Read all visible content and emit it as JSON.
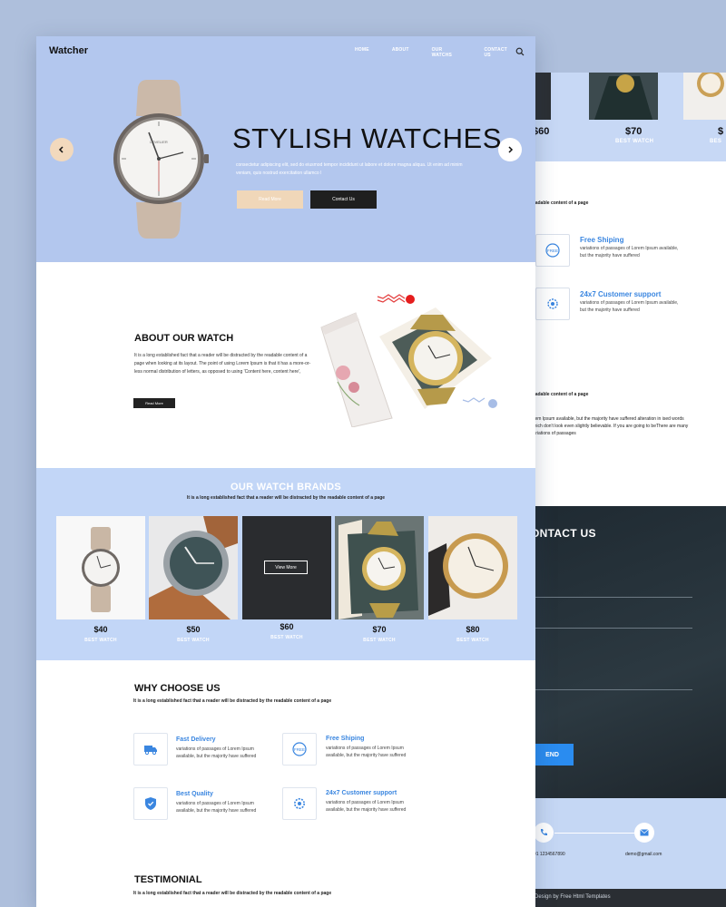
{
  "header": {
    "logo": "Watcher",
    "nav": [
      "HOME",
      "ABOUT",
      "OUR WATCHS",
      "CONTACT US"
    ]
  },
  "hero": {
    "title": "STYLISH WATCHES",
    "description": "consectetur adipiscing elit, sed do eiusmod tempor incididunt ut labore et dolore magna aliqua. Ut enim ad minim veniam, quis nostrud exercitation ullamco l",
    "read_more": "Read More",
    "contact_us": "Contact Us",
    "watch_brand_text": "LOVELIER"
  },
  "about": {
    "title": "ABOUT OUR WATCH",
    "text": "It is a long established fact that a reader will be distracted by the readable content of a page when looking at its layout. The point of using Lorem Ipsum is that it has a more-or-less normal distribution of letters, as opposed to using 'Content here, content here',",
    "button": "Read More"
  },
  "brands": {
    "title": "OUR WATCH BRANDS",
    "subtitle": "It is a long established fact that a reader will be distracted by the readable content of a page",
    "items": [
      {
        "price": "$40",
        "label": "BEST WATCH"
      },
      {
        "price": "$50",
        "label": "BEST WATCH"
      },
      {
        "price": "$60",
        "label": "BEST WATCH"
      },
      {
        "price": "$70",
        "label": "BEST WATCH"
      },
      {
        "price": "$80",
        "label": "BEST WATCH"
      }
    ],
    "view_more": "View More"
  },
  "why": {
    "title": "WHY CHOOSE US",
    "subtitle": "It is a long established fact that a reader will be distracted by the readable content of a page",
    "features": [
      {
        "title": "Fast Delivery",
        "desc": "variations of passages of Lorem Ipsum available, but the majority have suffered",
        "icon": "truck-icon"
      },
      {
        "title": "Free Shiping",
        "desc": "variations of passages of Lorem Ipsum available, but the majority have suffered",
        "icon": "free-badge-icon"
      },
      {
        "title": "Best Quality",
        "desc": "variations of passages of Lorem Ipsum available, but the majority have suffered",
        "icon": "shield-icon"
      },
      {
        "title": "24x7 Customer support",
        "desc": "variations of passages of Lorem Ipsum available, but the majority have suffered",
        "icon": "support-gear-icon"
      }
    ]
  },
  "testimonial": {
    "title": "TESTIMONIAL",
    "subtitle": "It is a long established fact that a reader will be distracted by the readable content of a page"
  },
  "back_page": {
    "prices": [
      "$60",
      "$70",
      "$"
    ],
    "labels": [
      "BEST WATCH",
      "BES"
    ],
    "readable_1": "readable content of a page",
    "feature_1_title": "Free Shiping",
    "feature_1_desc": "variations of passages of Lorem Ipsum available, but the majority have suffered",
    "feature_2_title": "24x7 Customer support",
    "feature_2_desc": "variations of passages of Lorem Ipsum available, but the majority have suffered",
    "readable_2": "readable content of a page",
    "paragraph": "orem Ipsum available, but the majority have suffered alteration in ised words which don't look even slightly believable. If you are going to beThere are many variations of passages",
    "contact_title": "ONTACT US",
    "send": "END",
    "phone": "+01 1234567890",
    "email": "demo@gmail.com",
    "footer": "Design by Free Html Templates"
  },
  "colors": {
    "hero_bg": "#b3c7ee",
    "brands_bg": "#c2d6f7",
    "accent_blue": "#3a86e0",
    "peach": "#f0d7b9",
    "dark": "#1f1f1f"
  }
}
